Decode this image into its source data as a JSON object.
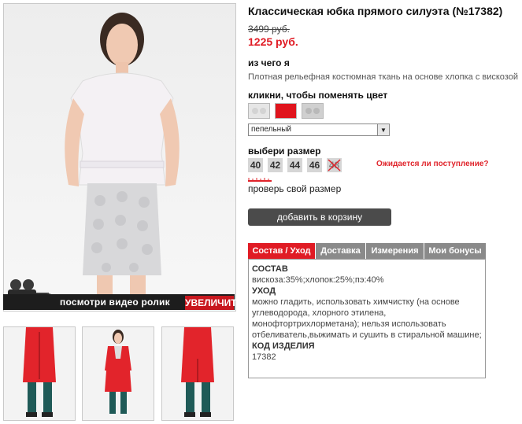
{
  "product": {
    "title": "Классическая юбка прямого силуэта (№17382)",
    "old_price": "3499 руб.",
    "new_price": "1225 руб."
  },
  "media": {
    "video_label": "посмотри видео ролик",
    "zoom_label": "УВЕЛИЧИТЬ",
    "thumbnails": [
      "skirt-front",
      "model-full",
      "skirt-back"
    ]
  },
  "material": {
    "label": "из чего я",
    "text": "Плотная рельефная костюмная ткань на основе хлопка с вискозой"
  },
  "color": {
    "label": "кликни, чтобы поменять цвет",
    "swatches": [
      {
        "name": "light-gray",
        "hex": "#e4e4e4"
      },
      {
        "name": "red",
        "hex": "#e0141d"
      },
      {
        "name": "gray-pattern",
        "hex": "#d0d0d0"
      }
    ],
    "selected": "пепельный"
  },
  "size": {
    "label": "выбери размер",
    "options": [
      "40",
      "42",
      "44",
      "46",
      "48"
    ],
    "unavailable": [
      "48"
    ],
    "waiting_link": "Ожидается ли поступление?",
    "check_label": "проверь свой размер"
  },
  "cart": {
    "button_label": "добавить в корзину"
  },
  "tabs": {
    "items": [
      "Состав / Уход",
      "Доставка",
      "Измерения",
      "Мои бонусы"
    ],
    "active": "Состав / Уход",
    "content": {
      "composition_heading": "СОСТАВ",
      "composition_text": "вискоза:35%;хлопок:25%;пэ:40%",
      "care_heading": "УХОД",
      "care_text": "можно гладить, использовать химчистку (на основе углеводорода, хлорного этилена, монофтортрихлорметана); нельзя использовать отбеливатель,выжимать и сушить в стиральной машине;",
      "code_heading": "КОД ИЗДЕЛИЯ",
      "code_value": "17382"
    }
  },
  "colors": {
    "accent": "#e01b24",
    "tab_inactive": "#8a8a8a",
    "button": "#4b4b4b"
  }
}
